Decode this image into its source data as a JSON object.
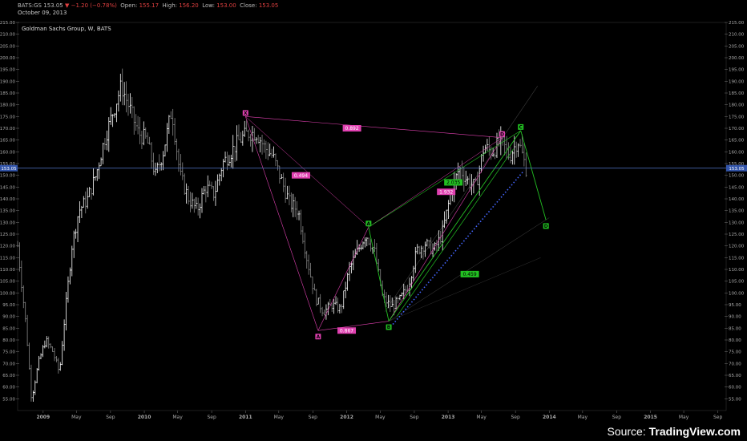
{
  "header": {
    "symbol": "BATS:GS",
    "last": "153.05",
    "arrow": "▼",
    "change": "−1.20 (−0.78%)",
    "open_label": "Open:",
    "open": "155.17",
    "high_label": "High:",
    "high": "156.20",
    "low_label": "Low:",
    "low": "153.00",
    "close_label": "Close:",
    "close": "153.05",
    "date": "October 09, 2013"
  },
  "attribution": {
    "prefix": "Source: ",
    "brand": "TradingView.com"
  },
  "colors": {
    "up": "#ffffff",
    "down": "#888888",
    "bull": "#22c022",
    "bear": "#e040b0",
    "dots": "#4466ff",
    "price_line": "#5577cc"
  },
  "chart_data": {
    "type": "line",
    "title": "Goldman Sachs Group, W, BATS",
    "ylim": [
      50,
      215
    ],
    "yticks": [
      "55.00",
      "60.00",
      "65.00",
      "70.00",
      "75.00",
      "80.00",
      "85.00",
      "90.00",
      "95.00",
      "100.00",
      "105.00",
      "110.00",
      "115.00",
      "120.00",
      "125.00",
      "130.00",
      "135.00",
      "140.00",
      "145.00",
      "150.00",
      "155.00",
      "160.00",
      "165.00",
      "170.00",
      "175.00",
      "180.00",
      "185.00",
      "190.00",
      "195.00",
      "200.00",
      "205.00",
      "210.00",
      "215.00"
    ],
    "current_price": 153.05,
    "current_price_label": "153.05",
    "x_start": "2008-10-01",
    "x_end": "2015-10-01",
    "xticks": [
      {
        "date": "2009-01-01",
        "label": "2009"
      },
      {
        "date": "2009-05-01",
        "label": "May"
      },
      {
        "date": "2009-09-01",
        "label": "Sep"
      },
      {
        "date": "2010-01-01",
        "label": "2010"
      },
      {
        "date": "2010-05-01",
        "label": "May"
      },
      {
        "date": "2010-09-01",
        "label": "Sep"
      },
      {
        "date": "2011-01-01",
        "label": "2011"
      },
      {
        "date": "2011-05-01",
        "label": "May"
      },
      {
        "date": "2011-09-01",
        "label": "Sep"
      },
      {
        "date": "2012-01-01",
        "label": "2012"
      },
      {
        "date": "2012-05-01",
        "label": "May"
      },
      {
        "date": "2012-09-01",
        "label": "Sep"
      },
      {
        "date": "2013-01-01",
        "label": "2013"
      },
      {
        "date": "2013-05-01",
        "label": "May"
      },
      {
        "date": "2013-09-01",
        "label": "Sep"
      },
      {
        "date": "2014-01-01",
        "label": "2014"
      },
      {
        "date": "2014-05-01",
        "label": "May"
      },
      {
        "date": "2014-09-01",
        "label": "Sep"
      },
      {
        "date": "2015-01-01",
        "label": "2015"
      },
      {
        "date": "2015-05-01",
        "label": "May"
      },
      {
        "date": "2015-09-01",
        "label": "Sep"
      }
    ],
    "price_path": [
      [
        "2008-10-01",
        120
      ],
      [
        "2008-11-01",
        85
      ],
      [
        "2008-11-20",
        55
      ],
      [
        "2008-12-15",
        70
      ],
      [
        "2009-01-10",
        80
      ],
      [
        "2009-02-05",
        75
      ],
      [
        "2009-03-01",
        66
      ],
      [
        "2009-03-20",
        90
      ],
      [
        "2009-04-15",
        120
      ],
      [
        "2009-05-10",
        135
      ],
      [
        "2009-06-10",
        140
      ],
      [
        "2009-07-10",
        150
      ],
      [
        "2009-08-10",
        165
      ],
      [
        "2009-09-10",
        177
      ],
      [
        "2009-10-10",
        188
      ],
      [
        "2009-11-10",
        178
      ],
      [
        "2009-12-10",
        168
      ],
      [
        "2010-01-10",
        165
      ],
      [
        "2010-02-10",
        150
      ],
      [
        "2010-03-10",
        160
      ],
      [
        "2010-04-10",
        178
      ],
      [
        "2010-05-10",
        150
      ],
      [
        "2010-06-10",
        140
      ],
      [
        "2010-07-10",
        135
      ],
      [
        "2010-08-10",
        145
      ],
      [
        "2010-09-10",
        142
      ],
      [
        "2010-10-10",
        155
      ],
      [
        "2010-11-10",
        160
      ],
      [
        "2010-12-10",
        165
      ],
      [
        "2011-01-10",
        168
      ],
      [
        "2011-02-10",
        168
      ],
      [
        "2011-03-10",
        162
      ],
      [
        "2011-04-10",
        158
      ],
      [
        "2011-05-10",
        148
      ],
      [
        "2011-06-10",
        138
      ],
      [
        "2011-07-10",
        135
      ],
      [
        "2011-08-10",
        115
      ],
      [
        "2011-09-10",
        98
      ],
      [
        "2011-10-10",
        92
      ],
      [
        "2011-11-10",
        95
      ],
      [
        "2011-12-10",
        93
      ],
      [
        "2012-01-10",
        110
      ],
      [
        "2012-02-10",
        118
      ],
      [
        "2012-03-10",
        125
      ],
      [
        "2012-04-10",
        118
      ],
      [
        "2012-05-10",
        98
      ],
      [
        "2012-06-10",
        94
      ],
      [
        "2012-07-10",
        97
      ],
      [
        "2012-08-10",
        103
      ],
      [
        "2012-09-10",
        118
      ],
      [
        "2012-10-10",
        121
      ],
      [
        "2012-11-10",
        118
      ],
      [
        "2012-12-10",
        125
      ],
      [
        "2013-01-10",
        142
      ],
      [
        "2013-02-10",
        153
      ],
      [
        "2013-03-10",
        148
      ],
      [
        "2013-04-10",
        145
      ],
      [
        "2013-05-10",
        162
      ],
      [
        "2013-06-10",
        160
      ],
      [
        "2013-07-10",
        165
      ],
      [
        "2013-08-10",
        158
      ],
      [
        "2013-09-10",
        165
      ],
      [
        "2013-10-09",
        153
      ]
    ],
    "annotations": {
      "pattern_points": [
        {
          "label": "X",
          "date": "2011-01-01",
          "price": 175,
          "color": "bear"
        },
        {
          "label": "A",
          "date": "2011-09-20",
          "price": 84,
          "color": "bear"
        },
        {
          "label": "A",
          "date": "2012-03-20",
          "price": 128,
          "color": "bull"
        },
        {
          "label": "B",
          "date": "2012-06-01",
          "price": 88,
          "color": "bull"
        },
        {
          "label": "D",
          "date": "2013-07-15",
          "price": 166,
          "color": "bear"
        },
        {
          "label": "C",
          "date": "2013-09-20",
          "price": 169,
          "color": "bull"
        },
        {
          "label": "D",
          "date": "2013-12-20",
          "price": 131,
          "color": "bull"
        }
      ],
      "ratios": [
        {
          "label": "0.892",
          "date": "2012-01-20",
          "price": 170,
          "color": "bear"
        },
        {
          "label": "0.494",
          "date": "2011-07-20",
          "price": 150,
          "color": "bear"
        },
        {
          "label": "0.867",
          "date": "2012-01-01",
          "price": 84,
          "color": "bear"
        },
        {
          "label": "2.035",
          "date": "2013-01-20",
          "price": 147,
          "color": "bull"
        },
        {
          "label": "1.932",
          "date": "2012-12-25",
          "price": 143,
          "color": "bear"
        },
        {
          "label": "0.459",
          "date": "2013-03-20",
          "price": 108,
          "color": "bull"
        }
      ]
    }
  }
}
